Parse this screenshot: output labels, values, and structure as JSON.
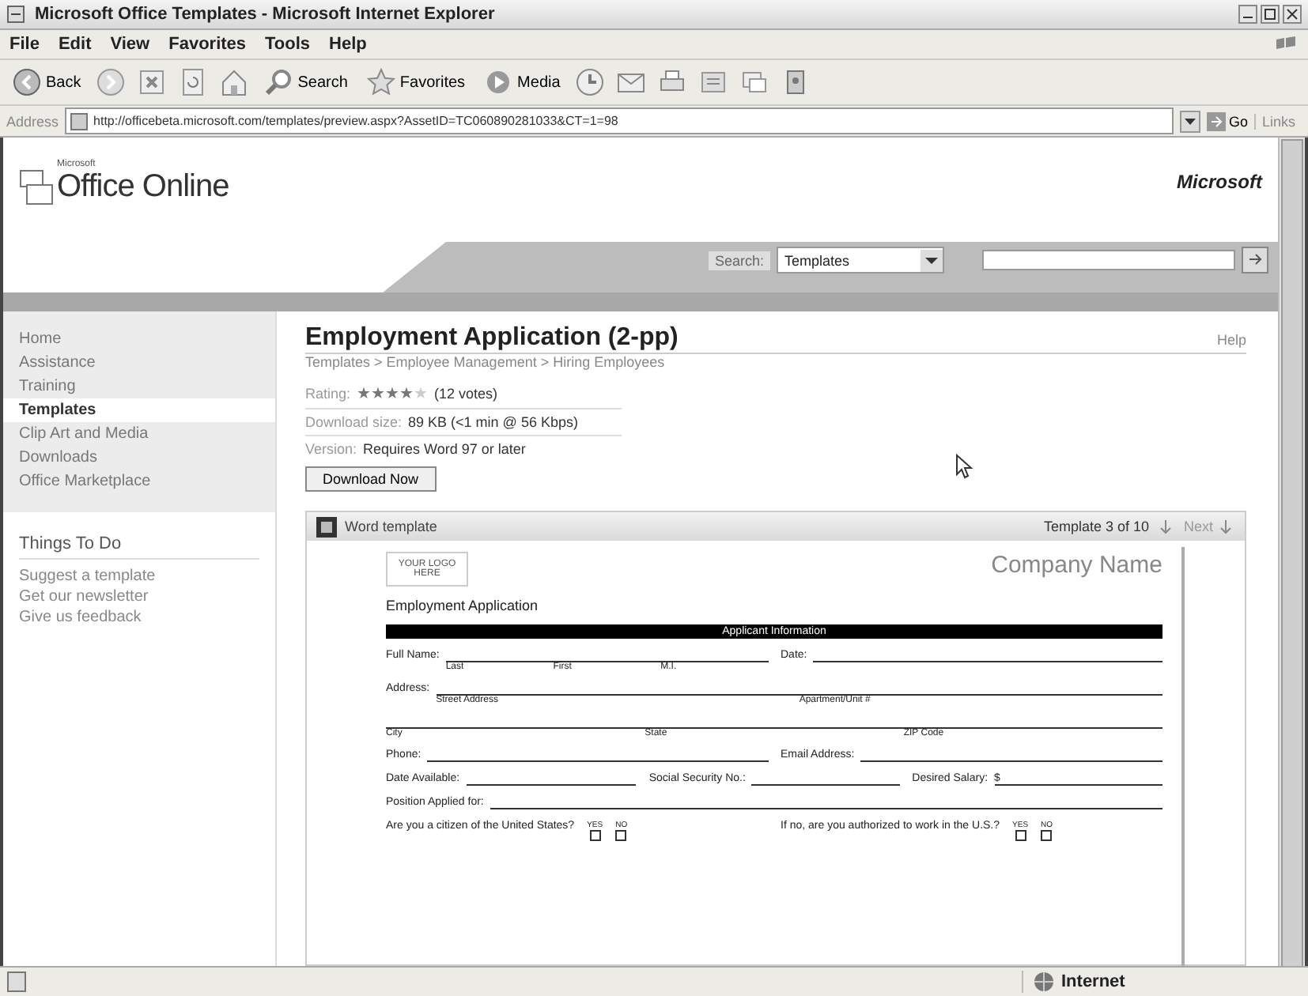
{
  "window": {
    "title": "Microsoft Office Templates - Microsoft Internet Explorer"
  },
  "menu": [
    "File",
    "Edit",
    "View",
    "Favorites",
    "Tools",
    "Help"
  ],
  "toolbar": [
    {
      "kind": "back",
      "label": "Back"
    },
    {
      "kind": "forward"
    },
    {
      "kind": "stop"
    },
    {
      "kind": "refresh"
    },
    {
      "kind": "home"
    },
    {
      "kind": "search",
      "label": "Search"
    },
    {
      "kind": "favorites",
      "label": "Favorites"
    },
    {
      "kind": "media",
      "label": "Media"
    },
    {
      "kind": "history"
    },
    {
      "kind": "mail"
    },
    {
      "kind": "print"
    },
    {
      "kind": "edit"
    },
    {
      "kind": "discuss"
    },
    {
      "kind": "messenger"
    }
  ],
  "address": {
    "label": "Address",
    "value": "http://officebeta.microsoft.com/templates/preview.aspx?AssetID=TC060890281033&CT=1=98",
    "go": "Go",
    "links": "Links"
  },
  "site": {
    "logo_small": "Microsoft",
    "logo": "Office Online",
    "brand": "Microsoft",
    "search_label": "Search:",
    "search_scope": "Templates"
  },
  "sidebar": {
    "items": [
      {
        "label": "Home",
        "selected": false
      },
      {
        "label": "Assistance",
        "selected": false
      },
      {
        "label": "Training",
        "selected": false
      },
      {
        "label": "Templates",
        "selected": true
      },
      {
        "label": "Clip Art and Media",
        "selected": false
      },
      {
        "label": "Downloads",
        "selected": false
      },
      {
        "label": "Office Marketplace",
        "selected": false
      }
    ],
    "todo_title": "Things To Do",
    "todo": [
      "Suggest a template",
      "Get our newsletter",
      "Give us feedback"
    ]
  },
  "main": {
    "title": "Employment Application (2-pp)",
    "help": "Help",
    "breadcrumb": "Templates > Employee Management > Hiring Employees",
    "rating_label": "Rating:",
    "stars": 4,
    "votes": "(12 votes)",
    "size_label": "Download size:",
    "size": "89 KB (<1 min @ 56 Kbps)",
    "version_label": "Version:",
    "version": "Requires Word 97 or later",
    "download": "Download Now"
  },
  "preview": {
    "type": "Word template",
    "position": "Template 3 of 10",
    "next": "Next",
    "document": {
      "logo": "YOUR LOGO HERE",
      "company": "Company Name",
      "heading": "Employment Application",
      "section": "Applicant Information",
      "rows": [
        [
          {
            "label": "Full Name:",
            "captions": [
              "Last",
              "First",
              "M.I."
            ]
          },
          {
            "label": "Date:"
          }
        ],
        [
          {
            "label": "Address:",
            "captions": [
              "Street Address",
              "Apartment/Unit #"
            ]
          }
        ],
        [
          {
            "captions": [
              "City",
              "State",
              "ZIP Code"
            ]
          }
        ],
        [
          {
            "label": "Phone:"
          },
          {
            "label": "Email Address:"
          }
        ],
        [
          {
            "label": "Date Available:"
          },
          {
            "label": "Social Security No.:"
          },
          {
            "label": "Desired Salary:",
            "prefix": "$"
          }
        ],
        [
          {
            "label": "Position Applied for:"
          }
        ],
        [
          {
            "label": "Are you a citizen of the United States?",
            "options": [
              {
                "label": "YES",
                "checked": false
              },
              {
                "label": "NO",
                "checked": false
              }
            ]
          },
          {
            "label": "If no, are you authorized to work in the U.S.?",
            "options": [
              {
                "label": "YES",
                "checked": false
              },
              {
                "label": "NO",
                "checked": false
              }
            ]
          }
        ]
      ]
    }
  },
  "status_bar": {
    "zone": "Internet"
  }
}
